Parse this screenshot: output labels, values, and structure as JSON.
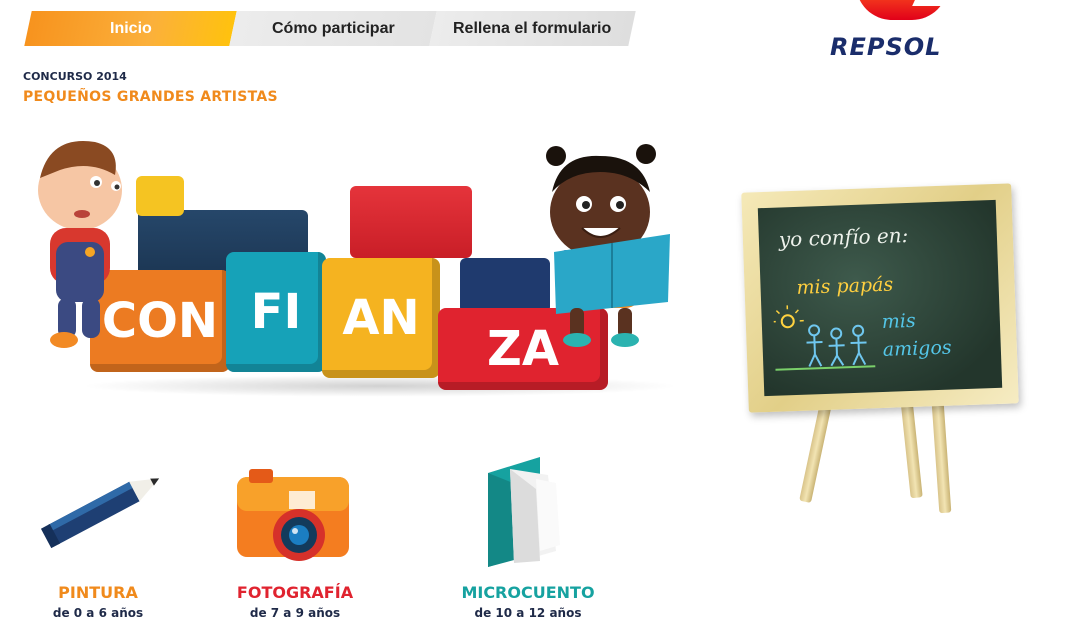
{
  "nav": {
    "tabs": [
      {
        "label": "Inicio",
        "active": true
      },
      {
        "label": "Cómo participar",
        "active": false
      },
      {
        "label": "Rellena el formulario",
        "active": false
      }
    ]
  },
  "brand": {
    "logo_text": "REPSOL",
    "colors": {
      "navy": "#1a2d6b",
      "red": "#e10019",
      "orange": "#ff5a1f"
    }
  },
  "header": {
    "contest_year": "CONCURSO 2014",
    "contest_name": "PEQUEÑOS GRANDES ARTISTAS"
  },
  "hero": {
    "blocks": [
      {
        "text": "CON",
        "color": "#ec7b22"
      },
      {
        "text": "FI",
        "color": "#16a2b8"
      },
      {
        "text": "AN",
        "color": "#f5b320"
      },
      {
        "text": "ZA",
        "color": "#e0232f"
      }
    ]
  },
  "chalkboard": {
    "line1": "yo confío en:",
    "line2": "mis papás",
    "line3": "mis",
    "line4": "amigos"
  },
  "categories": [
    {
      "title": "PINTURA",
      "ages": "de 0 a 6 años",
      "color": "#f08a1c",
      "icon": "pencil-icon"
    },
    {
      "title": "FOTOGRAFÍA",
      "ages": "de 7 a 9 años",
      "color": "#e0232f",
      "icon": "camera-icon"
    },
    {
      "title": "MICROCUENTO",
      "ages": "de 10 a 12 años",
      "color": "#16a2a0",
      "icon": "book-icon"
    }
  ]
}
